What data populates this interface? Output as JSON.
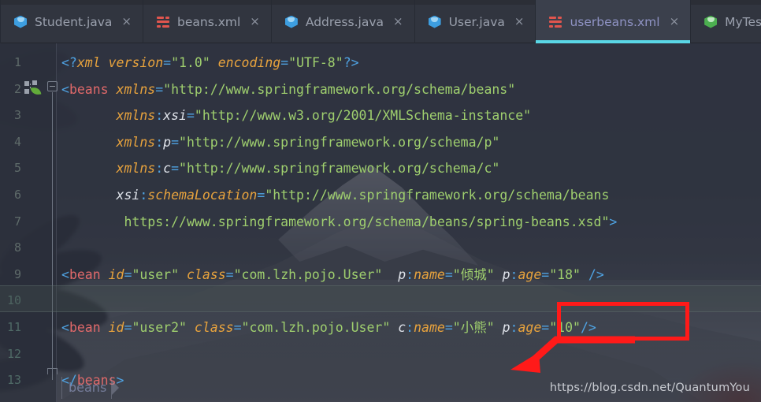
{
  "editor": {
    "tabs": [
      {
        "label": "Student.java",
        "icon": "java-class-icon",
        "active": false,
        "close": "×"
      },
      {
        "label": "beans.xml",
        "icon": "xml-file-icon",
        "active": false,
        "close": "×"
      },
      {
        "label": "Address.java",
        "icon": "java-class-icon",
        "active": false,
        "close": "×"
      },
      {
        "label": "User.java",
        "icon": "java-class-icon",
        "active": false,
        "close": "×"
      },
      {
        "label": "userbeans.xml",
        "icon": "xml-file-icon",
        "active": true,
        "close": "×"
      },
      {
        "label": "MyTest.java",
        "icon": "java-test-class-icon",
        "active": false,
        "close": "×"
      }
    ],
    "active_tab": "userbeans.xml",
    "language": "xml",
    "gutter": {
      "line_numbers": [
        "1",
        "2",
        "3",
        "4",
        "5",
        "6",
        "7",
        "8",
        "9",
        "10",
        "11",
        "12",
        "13"
      ],
      "current_line": "10",
      "icons": [
        {
          "line": "2",
          "name": "spring-bean-gutter-icon"
        }
      ],
      "fold_markers": [
        {
          "line": "2",
          "state": "expanded"
        }
      ]
    },
    "code_lines": [
      {
        "num": "1",
        "text": "<?xml version=\"1.0\" encoding=\"UTF-8\"?>"
      },
      {
        "num": "2",
        "text": "<beans xmlns=\"http://www.springframework.org/schema/beans\""
      },
      {
        "num": "3",
        "text": "       xmlns:xsi=\"http://www.w3.org/2001/XMLSchema-instance\""
      },
      {
        "num": "4",
        "text": "       xmlns:p=\"http://www.springframework.org/schema/p\""
      },
      {
        "num": "5",
        "text": "       xmlns:c=\"http://www.springframework.org/schema/c\""
      },
      {
        "num": "6",
        "text": "       xsi:schemaLocation=\"http://www.springframework.org/schema/beans"
      },
      {
        "num": "7",
        "text": "        https://www.springframework.org/schema/beans/spring-beans.xsd\">"
      },
      {
        "num": "8",
        "text": ""
      },
      {
        "num": "9",
        "text": "<bean id=\"user\" class=\"com.lzh.pojo.User\"  p:name=\"倾城\" p:age=\"18\" />"
      },
      {
        "num": "10",
        "text": ""
      },
      {
        "num": "11",
        "text": "<bean id=\"user2\" class=\"com.lzh.pojo.User\" c:name=\"小熊\" p:age=\"10\"/>"
      },
      {
        "num": "12",
        "text": ""
      },
      {
        "num": "13",
        "text": "</beans>"
      }
    ],
    "tokens": {
      "line1": [
        {
          "t": "<?",
          "k": "punct"
        },
        {
          "t": "xml",
          "k": "proc"
        },
        {
          "t": " ",
          "k": "plain"
        },
        {
          "t": "version",
          "k": "attr"
        },
        {
          "t": "=",
          "k": "punct"
        },
        {
          "t": "\"1.0\"",
          "k": "val"
        },
        {
          "t": " ",
          "k": "plain"
        },
        {
          "t": "encoding",
          "k": "attr"
        },
        {
          "t": "=",
          "k": "punct"
        },
        {
          "t": "\"UTF-8\"",
          "k": "val"
        },
        {
          "t": "?>",
          "k": "punct"
        }
      ],
      "line2": [
        {
          "t": "<",
          "k": "punct"
        },
        {
          "t": "beans",
          "k": "tag"
        },
        {
          "t": " ",
          "k": "plain"
        },
        {
          "t": "xmlns",
          "k": "attr"
        },
        {
          "t": "=",
          "k": "punct"
        },
        {
          "t": "\"http://www.springframework.org/schema/beans\"",
          "k": "val"
        }
      ],
      "line3": [
        {
          "t": "       ",
          "k": "plain"
        },
        {
          "t": "xmlns",
          "k": "attr"
        },
        {
          "t": ":",
          "k": "punct"
        },
        {
          "t": "xsi",
          "k": "ns"
        },
        {
          "t": "=",
          "k": "punct"
        },
        {
          "t": "\"http://www.w3.org/2001/XMLSchema-instance\"",
          "k": "val"
        }
      ],
      "line4": [
        {
          "t": "       ",
          "k": "plain"
        },
        {
          "t": "xmlns",
          "k": "attr"
        },
        {
          "t": ":",
          "k": "punct"
        },
        {
          "t": "p",
          "k": "ns"
        },
        {
          "t": "=",
          "k": "punct"
        },
        {
          "t": "\"http://www.springframework.org/schema/p\"",
          "k": "val"
        }
      ],
      "line5": [
        {
          "t": "       ",
          "k": "plain"
        },
        {
          "t": "xmlns",
          "k": "attr"
        },
        {
          "t": ":",
          "k": "punct"
        },
        {
          "t": "c",
          "k": "ns"
        },
        {
          "t": "=",
          "k": "punct"
        },
        {
          "t": "\"http://www.springframework.org/schema/c\"",
          "k": "val"
        }
      ],
      "line6": [
        {
          "t": "       ",
          "k": "plain"
        },
        {
          "t": "xsi",
          "k": "ns"
        },
        {
          "t": ":",
          "k": "punct"
        },
        {
          "t": "schemaLocation",
          "k": "attr"
        },
        {
          "t": "=",
          "k": "punct"
        },
        {
          "t": "\"http://www.springframework.org/schema/beans",
          "k": "val"
        }
      ],
      "line7": [
        {
          "t": "        ",
          "k": "plain"
        },
        {
          "t": "https://www.springframework.org/schema/beans/spring-beans.xsd\"",
          "k": "val"
        },
        {
          "t": ">",
          "k": "punct"
        }
      ],
      "line9": [
        {
          "t": "<",
          "k": "punct"
        },
        {
          "t": "bean",
          "k": "tag"
        },
        {
          "t": " ",
          "k": "plain"
        },
        {
          "t": "id",
          "k": "attr"
        },
        {
          "t": "=",
          "k": "punct"
        },
        {
          "t": "\"user\"",
          "k": "val"
        },
        {
          "t": " ",
          "k": "plain"
        },
        {
          "t": "class",
          "k": "attr"
        },
        {
          "t": "=",
          "k": "punct"
        },
        {
          "t": "\"com.lzh.pojo.User\"",
          "k": "val"
        },
        {
          "t": "  ",
          "k": "plain"
        },
        {
          "t": "p",
          "k": "ns"
        },
        {
          "t": ":",
          "k": "punct"
        },
        {
          "t": "name",
          "k": "attr"
        },
        {
          "t": "=",
          "k": "punct"
        },
        {
          "t": "\"倾城\"",
          "k": "val"
        },
        {
          "t": " ",
          "k": "plain"
        },
        {
          "t": "p",
          "k": "ns"
        },
        {
          "t": ":",
          "k": "punct"
        },
        {
          "t": "age",
          "k": "attr"
        },
        {
          "t": "=",
          "k": "punct"
        },
        {
          "t": "\"18\"",
          "k": "val"
        },
        {
          "t": " ",
          "k": "plain"
        },
        {
          "t": "/>",
          "k": "punct"
        }
      ],
      "line11": [
        {
          "t": "<",
          "k": "punct"
        },
        {
          "t": "bean",
          "k": "tag"
        },
        {
          "t": " ",
          "k": "plain"
        },
        {
          "t": "id",
          "k": "attr"
        },
        {
          "t": "=",
          "k": "punct"
        },
        {
          "t": "\"user2\"",
          "k": "val"
        },
        {
          "t": " ",
          "k": "plain"
        },
        {
          "t": "class",
          "k": "attr"
        },
        {
          "t": "=",
          "k": "punct"
        },
        {
          "t": "\"com.lzh.pojo.User\"",
          "k": "val"
        },
        {
          "t": " ",
          "k": "plain"
        },
        {
          "t": "c",
          "k": "ns"
        },
        {
          "t": ":",
          "k": "punct"
        },
        {
          "t": "name",
          "k": "attr"
        },
        {
          "t": "=",
          "k": "punct"
        },
        {
          "t": "\"小熊\"",
          "k": "val"
        },
        {
          "t": " ",
          "k": "plain"
        },
        {
          "t": "p",
          "k": "ns"
        },
        {
          "t": ":",
          "k": "punct"
        },
        {
          "t": "age",
          "k": "attr"
        },
        {
          "t": "=",
          "k": "punct"
        },
        {
          "t": "\"10\"",
          "k": "val"
        },
        {
          "t": "/>",
          "k": "punct"
        }
      ],
      "line13": [
        {
          "t": "</",
          "k": "punct"
        },
        {
          "t": "beans",
          "k": "tag"
        },
        {
          "t": ">",
          "k": "punct"
        }
      ]
    }
  },
  "breadcrumb": {
    "items": [
      "beans"
    ]
  },
  "annotation": {
    "highlight_text": "p:age=\"10\"/>",
    "color": "#ff1a19",
    "shape": "rectangle-with-arrow"
  },
  "watermark": {
    "text": "https://blog.csdn.net/QuantumYou"
  },
  "colors": {
    "tab_bar_bg": "#31353f",
    "active_tab_bg": "#3b404c",
    "active_tab_underline": "#5ad7e6",
    "tab_label": "#9aa0ad",
    "active_tab_label": "#8f93c4",
    "editor_bg": "#2b2f3a",
    "tag": "#e0696a",
    "attribute": "#e8a33d",
    "string_value": "#9fcf6e",
    "punctuation": "#4fa3e3",
    "namespace": "#dfe3ea",
    "line_number": "#5f6b6a",
    "annotation_red": "#ff1a19"
  }
}
